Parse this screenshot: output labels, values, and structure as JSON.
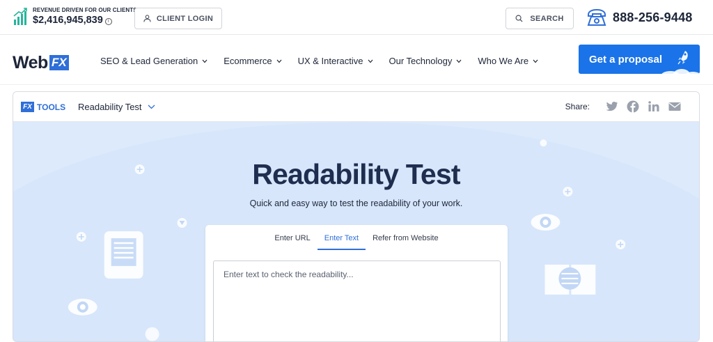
{
  "topbar": {
    "revenue_caption": "REVENUE DRIVEN FOR OUR CLIENTS",
    "revenue_amount": "$2,416,945,839",
    "info_symbol": "i",
    "client_login_label": "CLIENT LOGIN",
    "search_label": "SEARCH",
    "phone_number": "888-256-9448"
  },
  "nav": {
    "logo_web": "Web",
    "logo_fx": "FX",
    "items": [
      {
        "label": "SEO & Lead Generation"
      },
      {
        "label": "Ecommerce"
      },
      {
        "label": "UX & Interactive"
      },
      {
        "label": "Our Technology"
      },
      {
        "label": "Who We Are"
      }
    ],
    "cta_label": "Get a proposal"
  },
  "tool_panel": {
    "badge": "FX",
    "tools_label": "TOOLS",
    "selected_tool": "Readability Test",
    "share_label": "Share:",
    "share_icons": [
      "twitter-icon",
      "facebook-icon",
      "linkedin-icon",
      "email-icon"
    ]
  },
  "hero": {
    "title": "Readability Test",
    "subtitle": "Quick and easy way to test the readability of your work."
  },
  "input_card": {
    "tabs": [
      {
        "label": "Enter URL",
        "active": false
      },
      {
        "label": "Enter Text",
        "active": true
      },
      {
        "label": "Refer from Website",
        "active": false
      }
    ],
    "textarea_placeholder": "Enter text to check the readability...",
    "textarea_value": ""
  },
  "colors": {
    "brand_blue": "#2f6fd8",
    "cta_blue": "#1a73e8",
    "hero_bg": "#ddeafc",
    "title_navy": "#1f2d4e"
  }
}
